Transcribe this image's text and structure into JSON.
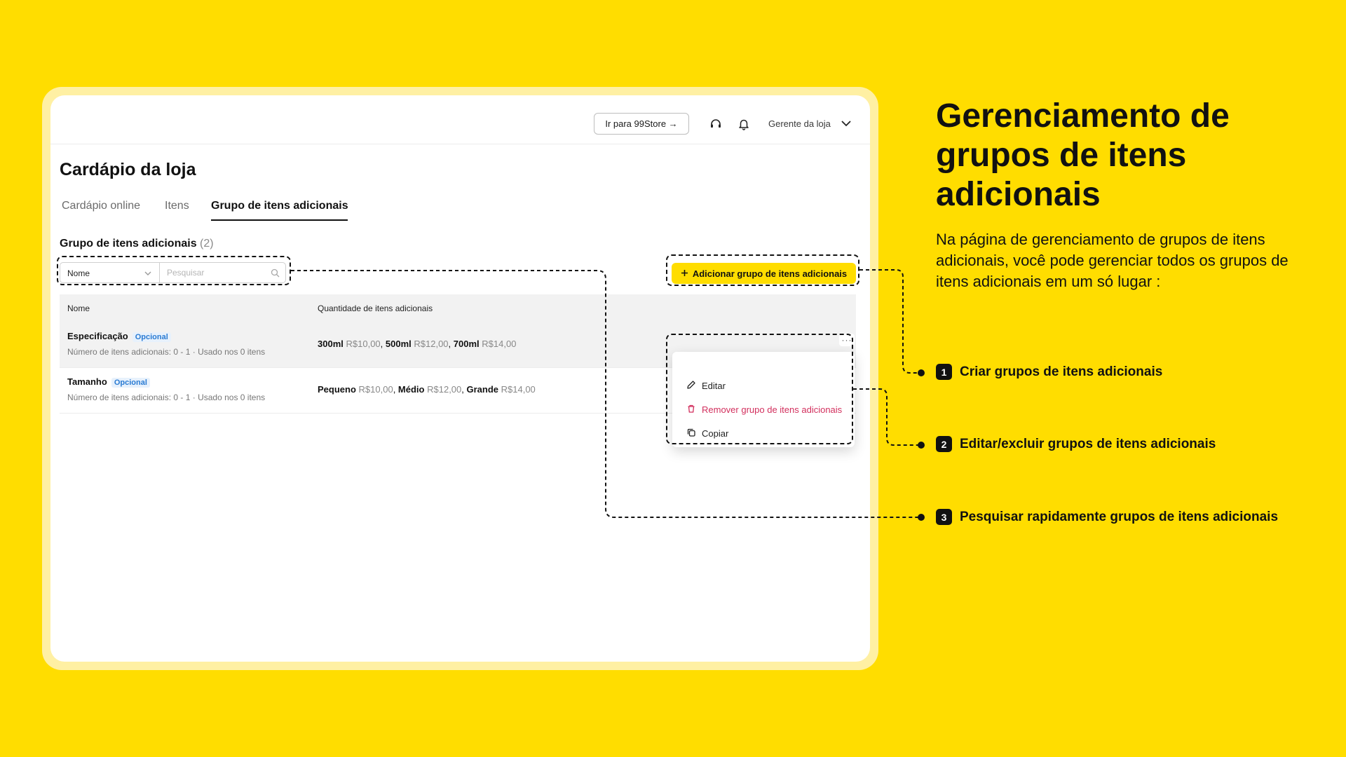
{
  "app": {
    "store_button": "Ir para 99Store →",
    "user_name": "Gerente da loja",
    "icons": {
      "support": "headset-icon",
      "notifications": "bell-icon",
      "dropdown": "chevron-down-icon"
    }
  },
  "page": {
    "title": "Cardápio da loja",
    "tabs": [
      {
        "label": "Cardápio online",
        "active": false
      },
      {
        "label": "Itens",
        "active": false
      },
      {
        "label": "Grupo de itens adicionais",
        "active": true
      }
    ],
    "section_title": "Grupo de itens adicionais",
    "section_count": "(2)"
  },
  "filter": {
    "select_value": "Nome",
    "search_placeholder": "Pesquisar"
  },
  "add_button": {
    "label": "Adicionar grupo de itens adicionais",
    "icon": "plus-icon"
  },
  "table": {
    "headers": [
      "Nome",
      "Quantidade de itens adicionais"
    ],
    "rows": [
      {
        "name": "Especificação",
        "badge": "Opcional",
        "meta": "Número de itens adicionais: 0 - 1  ·  Usado nos 0 itens",
        "items": [
          {
            "name": "300ml",
            "price": "R$10,00"
          },
          {
            "name": "500ml",
            "price": "R$12,00"
          },
          {
            "name": "700ml",
            "price": "R$14,00"
          }
        ],
        "more": "···"
      },
      {
        "name": "Tamanho",
        "badge": "Opcional",
        "meta": "Número de itens adicionais: 0 - 1  ·  Usado nos 0 itens",
        "items": [
          {
            "name": "Pequeno",
            "price": "R$10,00"
          },
          {
            "name": "Médio",
            "price": "R$12,00"
          },
          {
            "name": "Grande",
            "price": "R$14,00"
          }
        ]
      }
    ]
  },
  "menu": {
    "edit": "Editar",
    "remove": "Remover grupo de itens adicionais",
    "copy": "Copiar"
  },
  "explainer": {
    "headline": "Gerenciamento de grupos de itens adicionais",
    "intro": "Na página de gerenciamento de grupos de itens adicionais, você pode gerenciar todos os grupos de itens adicionais em um só lugar :",
    "callouts": [
      {
        "number": "1",
        "text": "Criar grupos de itens adicionais"
      },
      {
        "number": "2",
        "text": "Editar/excluir grupos de itens adicionais"
      },
      {
        "number": "3",
        "text": "Pesquisar rapidamente grupos de itens adicionais"
      }
    ]
  },
  "colors": {
    "background": "#FFDD00",
    "accent": "#FFDD00",
    "danger": "#D22F5D",
    "badge": "#2A7BD3"
  }
}
